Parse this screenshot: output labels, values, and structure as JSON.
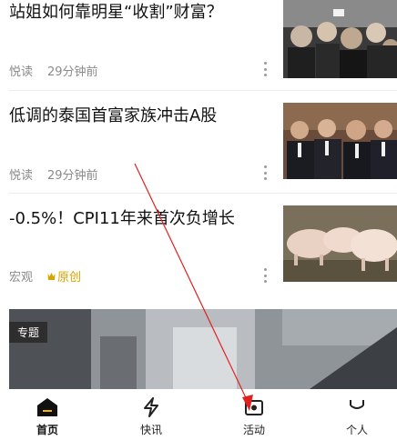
{
  "articles": [
    {
      "title": "站姐如何靠明星“收割”财富？",
      "source": "悦读",
      "time": "29分钟前",
      "badge": ""
    },
    {
      "title": "低调的泰国首富家族冲击A股",
      "source": "悦读",
      "time": "29分钟前",
      "badge": ""
    },
    {
      "title": "-0.5%！CPI11年来首次负增长",
      "source": "宏观",
      "time": "",
      "badge": "原创"
    }
  ],
  "topic": {
    "tag": "专题"
  },
  "tabbar": {
    "items": [
      {
        "label": "首页",
        "icon": "home-icon",
        "active": true
      },
      {
        "label": "快讯",
        "icon": "lightning-icon",
        "active": false
      },
      {
        "label": "活动",
        "icon": "activity-icon",
        "active": false
      },
      {
        "label": "个人",
        "icon": "person-icon",
        "active": false
      }
    ]
  },
  "colors": {
    "badge": "#d8a400",
    "meta": "#8a8a8a",
    "annotation": "#e02020"
  }
}
